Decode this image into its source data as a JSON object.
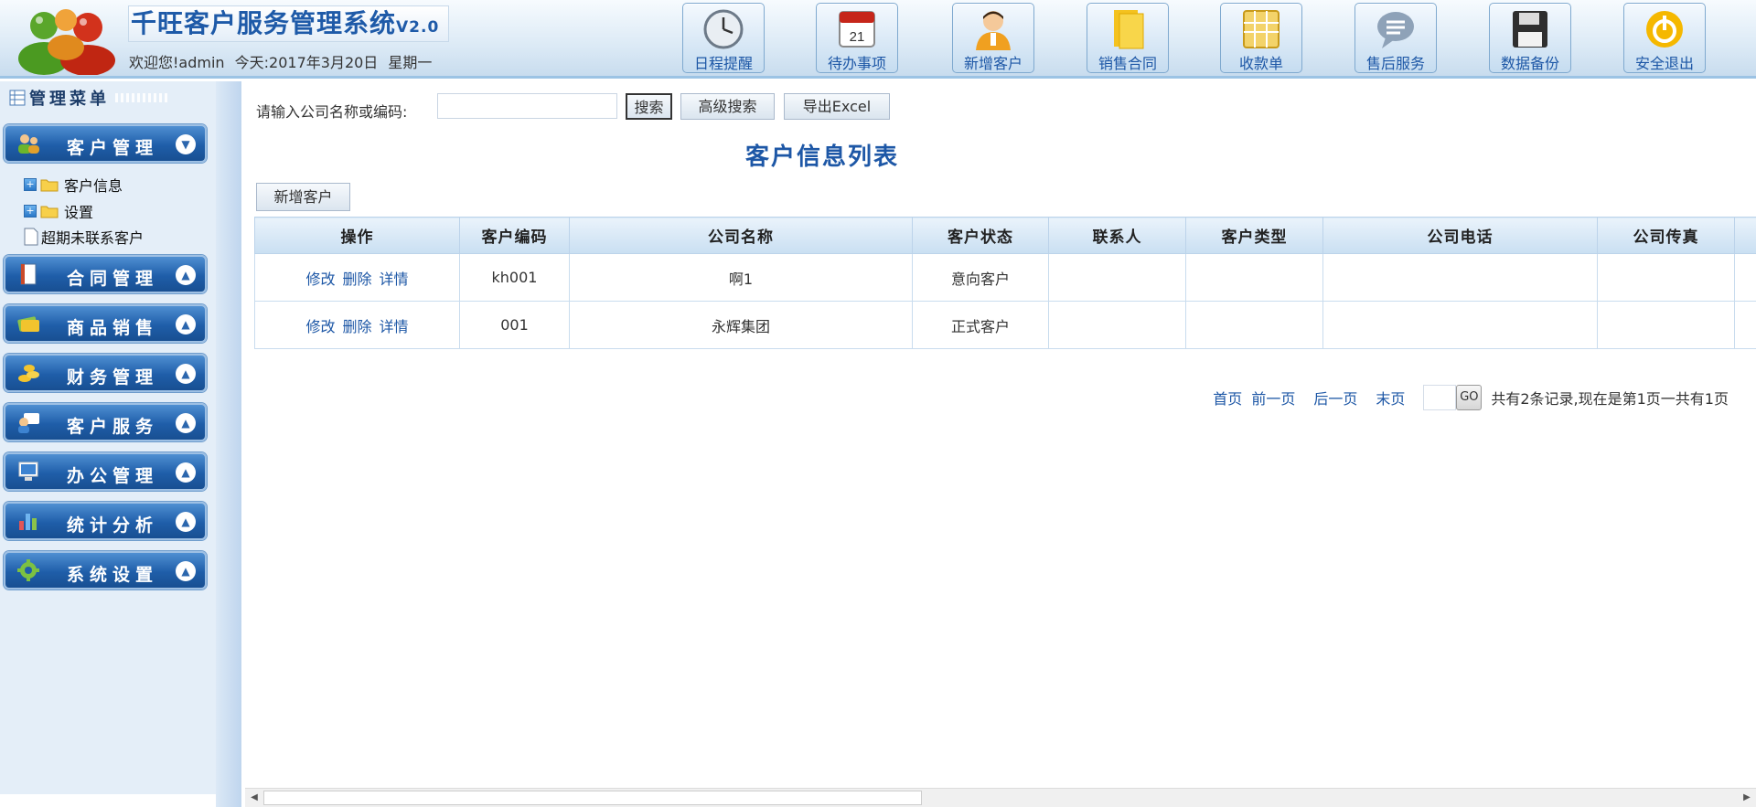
{
  "header": {
    "app_title": "千旺客户服务管理系统",
    "app_version": "V2.0",
    "welcome": "欢迎您!admin",
    "today": "今天:2017年3月20日",
    "weekday": "星期一",
    "toolbar": [
      {
        "label": "日程提醒",
        "icon": "clock-icon"
      },
      {
        "label": "待办事项",
        "icon": "calendar-icon"
      },
      {
        "label": "新增客户",
        "icon": "user-add-icon"
      },
      {
        "label": "销售合同",
        "icon": "contract-icon"
      },
      {
        "label": "收款单",
        "icon": "receipt-icon"
      },
      {
        "label": "售后服务",
        "icon": "chat-icon"
      },
      {
        "label": "数据备份",
        "icon": "floppy-icon"
      },
      {
        "label": "安全退出",
        "icon": "power-icon"
      }
    ]
  },
  "sidebar": {
    "title": "管理菜单",
    "menus": [
      {
        "label": "客户管理",
        "icon": "users-icon",
        "expanded": true
      },
      {
        "label": "合同管理",
        "icon": "book-icon",
        "expanded": false
      },
      {
        "label": "商品销售",
        "icon": "money-icon",
        "expanded": false
      },
      {
        "label": "财务管理",
        "icon": "coins-icon",
        "expanded": false
      },
      {
        "label": "客户服务",
        "icon": "service-icon",
        "expanded": false
      },
      {
        "label": "办公管理",
        "icon": "monitor-icon",
        "expanded": false
      },
      {
        "label": "统计分析",
        "icon": "bar-chart-icon",
        "expanded": false
      },
      {
        "label": "系统设置",
        "icon": "gear-icon",
        "expanded": false
      }
    ],
    "submenu": [
      {
        "label": "客户信息",
        "type": "folder"
      },
      {
        "label": "设置",
        "type": "folder"
      },
      {
        "label": "超期未联系客户",
        "type": "page"
      }
    ]
  },
  "search": {
    "label": "请输入公司名称或编码:",
    "value": "",
    "search_btn": "搜索",
    "advanced_btn": "高级搜索",
    "export_btn": "导出Excel"
  },
  "main": {
    "title": "客户信息列表",
    "add_btn": "新增客户",
    "columns": [
      "操作",
      "客户编码",
      "公司名称",
      "客户状态",
      "联系人",
      "客户类型",
      "公司电话",
      "公司传真",
      ""
    ],
    "row_actions": [
      "修改",
      "删除",
      "详情"
    ],
    "rows": [
      {
        "code": "kh001",
        "company": "啊1",
        "status": "意向客户",
        "contact": "",
        "type": "",
        "phone": "",
        "fax": ""
      },
      {
        "code": "001",
        "company": "永辉集团",
        "status": "正式客户",
        "contact": "",
        "type": "",
        "phone": "",
        "fax": ""
      }
    ]
  },
  "pager": {
    "first": "首页",
    "prev": "前一页",
    "next": "后一页",
    "last": "末页",
    "go": "GO",
    "summary": "共有2条记录,现在是第1页一共有1页"
  }
}
